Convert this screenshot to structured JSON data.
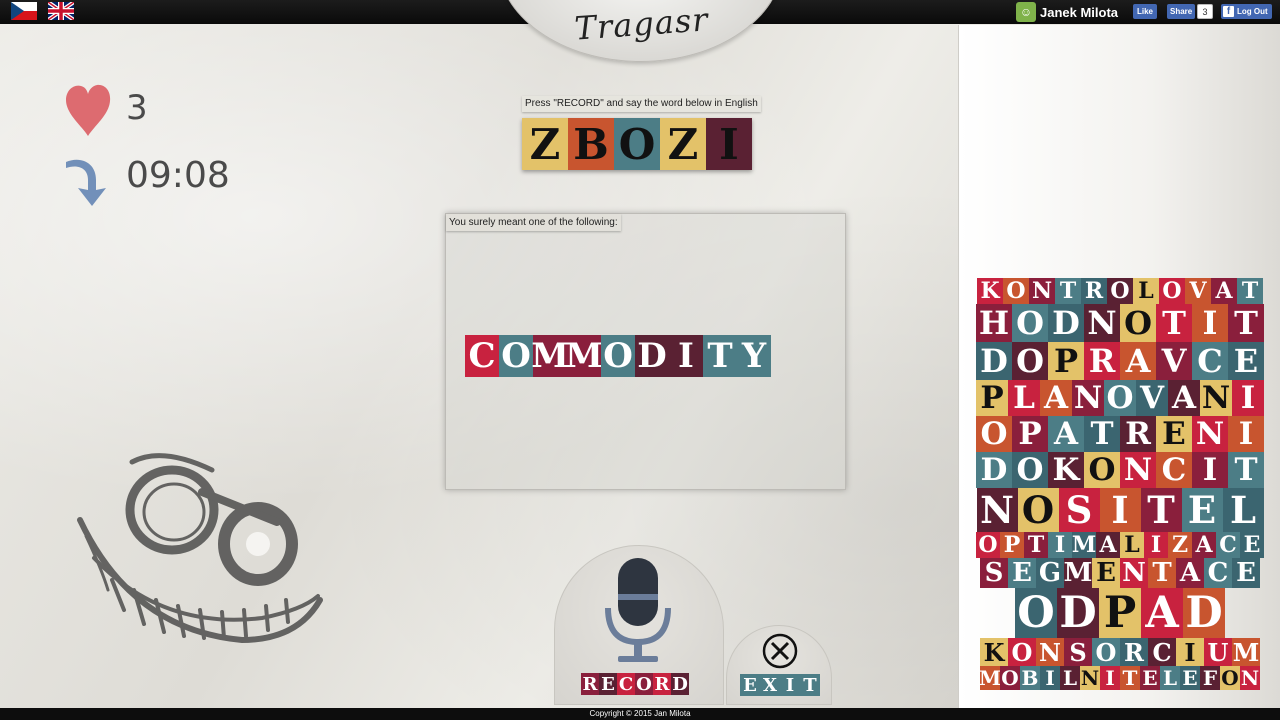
{
  "header": {
    "flags": [
      {
        "name": "czech-flag-icon"
      },
      {
        "name": "uk-flag-icon"
      }
    ],
    "user_name": "Janek Milota",
    "like_label": "Like",
    "share_label": "Share",
    "share_count": "3",
    "logout_label": "Log Out"
  },
  "logo": {
    "text": "Tragasr"
  },
  "stats": {
    "lives": "3",
    "time": "09:08"
  },
  "prompt": {
    "instruction": "Press \"RECORD\" and say the word below in English",
    "word_letters": [
      "Z",
      "B",
      "O",
      "Z",
      "I"
    ],
    "word_colors": [
      "#e3c269",
      "#c8552f",
      "#4c7d86",
      "#e3c269",
      "#5a2133"
    ]
  },
  "suggestions": {
    "label": "You surely meant one of the following:",
    "word_letters": [
      "C",
      "O",
      "M",
      "M",
      "O",
      "D",
      "I",
      "T",
      "Y"
    ],
    "word_colors": [
      "#c8223f",
      "#4c7d86",
      "#8a1f3c",
      "#8a1f3c",
      "#4c7d86",
      "#5a2133",
      "#5a2133",
      "#4c7d86",
      "#4c7d86"
    ]
  },
  "controls": {
    "record_letters": [
      "R",
      "E",
      "C",
      "O",
      "R",
      "D"
    ],
    "record_colors": [
      "#8a1f3c",
      "#5a2133",
      "#c8223f",
      "#8a1f3c",
      "#c8223f",
      "#5a2133"
    ],
    "exit_letters": [
      "E",
      "X",
      "I",
      "T"
    ],
    "exit_colors": [
      "#4c7d86",
      "#4c7d86",
      "#4c7d86",
      "#4c7d86"
    ]
  },
  "word_list": [
    "KONTROLOVAT",
    "HODNOTIT",
    "DOPRAVCE",
    "PLANOVANI",
    "OPATRENI",
    "DOKONCIT",
    "NOSITEL",
    "OPTIMALIZACE",
    "SEGMENTACE",
    "ODPAD",
    "KONSORCIUM",
    "MOBILNITELEFON"
  ],
  "tile_palette": [
    "#c8223f",
    "#4c7d86",
    "#e3c269",
    "#8a1f3c",
    "#5a2133",
    "#c8552f",
    "#3b6570"
  ],
  "footer": {
    "copyright": "Copyright © 2015 Jan Milota"
  }
}
